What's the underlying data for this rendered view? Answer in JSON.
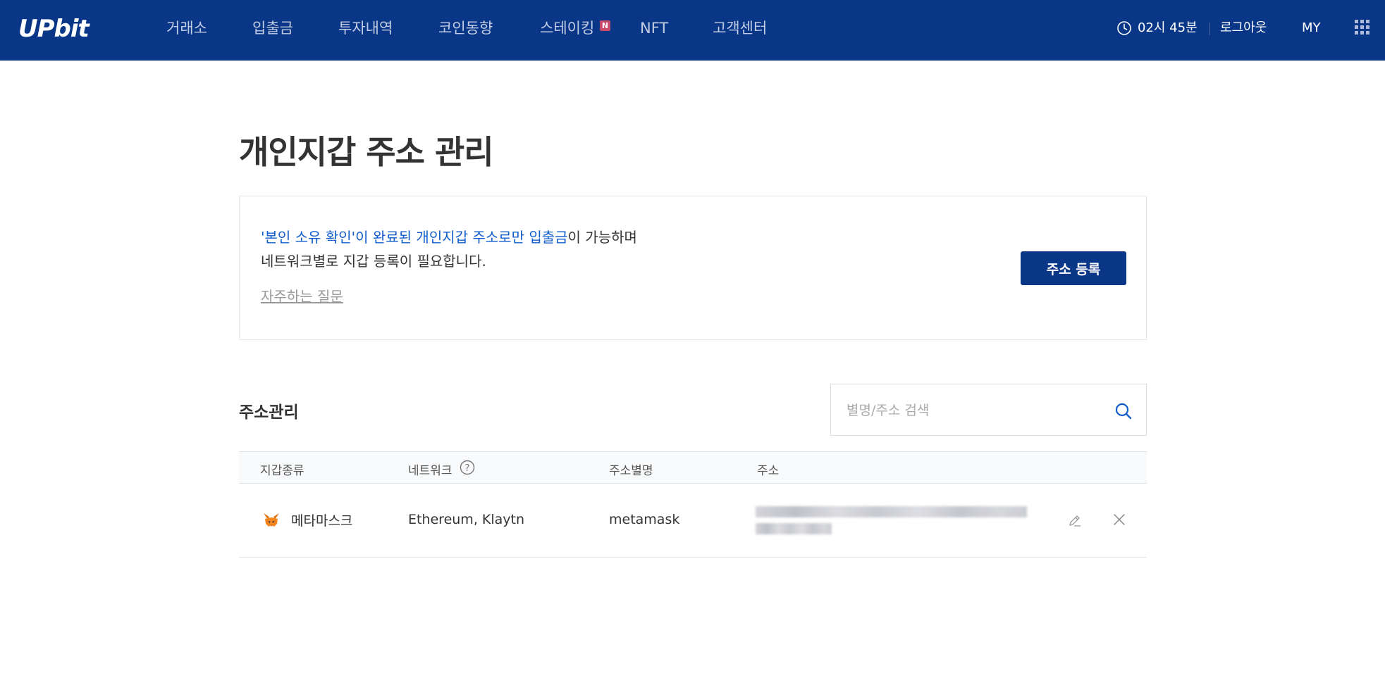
{
  "header": {
    "logo_text": "UPbit",
    "nav": [
      {
        "label": "거래소"
      },
      {
        "label": "입출금"
      },
      {
        "label": "투자내역"
      },
      {
        "label": "코인동향"
      },
      {
        "label": "스테이킹"
      },
      {
        "label": "NFT"
      },
      {
        "label": "고객센터"
      }
    ],
    "staking_badge": "N",
    "time": "02시 45분",
    "logout_label": "로그아웃",
    "my_label": "MY",
    "apps_icon": "grid-menu-icon"
  },
  "page": {
    "title": "개인지갑 주소 관리"
  },
  "notice": {
    "line1_highlight": "'본인 소유 확인'이 완료된 개인지갑 주소로만 입출금",
    "line1_rest": "이 가능하며",
    "line2": "네트워크별로 지갑 등록이 필요합니다.",
    "faq_link": "자주하는 질문",
    "register_button": "주소 등록"
  },
  "address_section": {
    "title": "주소관리",
    "search_placeholder": "별명/주소 검색",
    "search_value": "",
    "columns": {
      "wallet_type": "지갑종류",
      "network": "네트워크",
      "alias": "주소별명",
      "address": "주소"
    },
    "rows": [
      {
        "wallet_type": "메타마스크",
        "wallet_icon": "metamask-fox-icon",
        "network": "Ethereum, Klaytn",
        "alias": "metamask",
        "address_redacted": true
      }
    ]
  },
  "colors": {
    "brand_navy": "#093687",
    "link_blue": "#115dcb",
    "badge_red": "#c84a6b"
  }
}
